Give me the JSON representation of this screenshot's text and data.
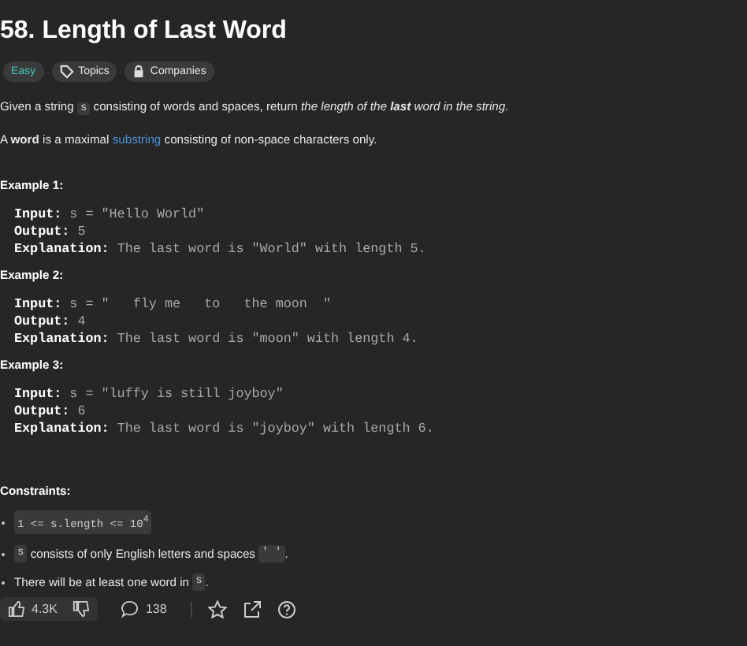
{
  "title": "58. Length of Last Word",
  "tags": [
    {
      "label": "Easy",
      "kind": "difficulty"
    },
    {
      "label": "Topics",
      "kind": "topics"
    },
    {
      "label": "Companies",
      "kind": "companies"
    }
  ],
  "description": [
    [
      {
        "kind": "text",
        "text": "Given a string "
      },
      {
        "kind": "code",
        "text": "s"
      },
      {
        "kind": "text",
        "text": " consisting of words and spaces, return "
      },
      {
        "kind": "emphasis",
        "text": "the length of the **last** word in the string."
      }
    ],
    [
      {
        "kind": "text",
        "text": "A **word** is a maximal "
      },
      {
        "kind": "link",
        "text": "substring"
      },
      {
        "kind": "text",
        "text": " consisting of non-space characters only."
      }
    ]
  ],
  "examples": [
    {
      "heading": "Example 1:",
      "lines": [
        {
          "label": "Input:",
          "value": "s = \"Hello World\""
        },
        {
          "label": "Output:",
          "value": "5"
        },
        {
          "label": "Explanation:",
          "value": "The last word is \"World\" with length 5."
        }
      ]
    },
    {
      "heading": "Example 2:",
      "lines": [
        {
          "label": "Input:",
          "value": "s = \"   fly me   to   the moon  \""
        },
        {
          "label": "Output:",
          "value": "4"
        },
        {
          "label": "Explanation:",
          "value": "The last word is \"moon\" with length 4."
        }
      ]
    },
    {
      "heading": "Example 3:",
      "lines": [
        {
          "label": "Input:",
          "value": "s = \"luffy is still joyboy\""
        },
        {
          "label": "Output:",
          "value": "6"
        },
        {
          "label": "Explanation:",
          "value": "The last word is \"joyboy\" with length 6."
        }
      ]
    }
  ],
  "constraints_heading": "Constraints:",
  "constraints": [
    [
      {
        "kind": "code",
        "text": "1 <= s.length <= 10$^{4}$"
      }
    ],
    [
      {
        "kind": "code",
        "text": "s"
      },
      {
        "kind": "text",
        "text": " consists of only English letters and spaces "
      },
      {
        "kind": "code",
        "text": "' '"
      },
      {
        "kind": "text",
        "text": "."
      }
    ],
    [
      {
        "kind": "text",
        "text": "There will be at least one word in "
      },
      {
        "kind": "code",
        "text": "s"
      },
      {
        "kind": "text",
        "text": "."
      }
    ]
  ],
  "footer": {
    "likes": "4.3K",
    "comments": "138"
  }
}
